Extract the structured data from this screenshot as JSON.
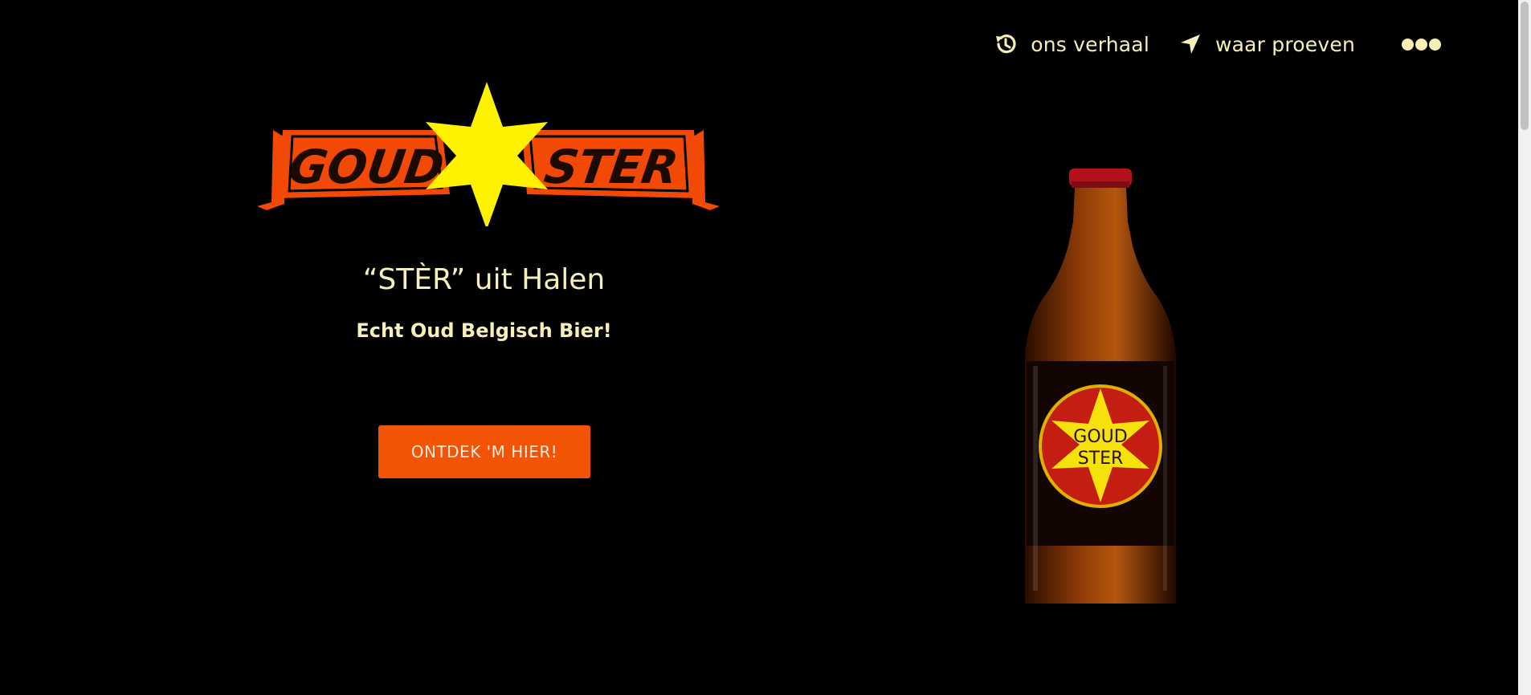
{
  "nav": {
    "items": [
      {
        "label": "ons verhaal",
        "icon": "history-icon"
      },
      {
        "label": "waar proeven",
        "icon": "location-arrow-icon"
      }
    ],
    "more_icon": "more-dots-icon"
  },
  "logo": {
    "left_word": "GOUD",
    "right_word": "STER"
  },
  "hero": {
    "title": "“STÈR” uit Halen",
    "subtitle": "Echt Oud Belgisch Bier!",
    "cta_label": "ONTDEK 'M HIER!"
  },
  "bottle": {
    "label_line1": "GOUD",
    "label_line2": "STER"
  },
  "colors": {
    "background": "#000000",
    "text": "#f7f0b6",
    "accent": "#f25304",
    "star": "#fff200"
  }
}
